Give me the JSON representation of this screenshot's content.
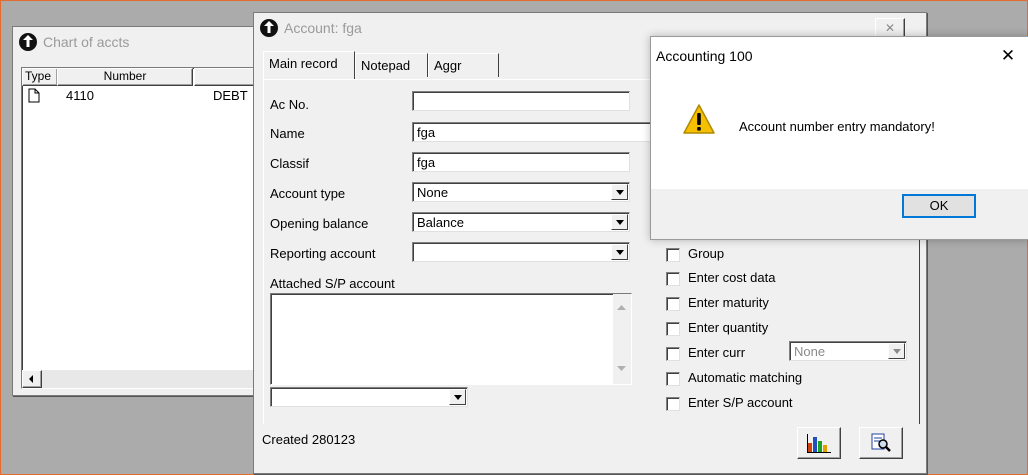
{
  "chart_window": {
    "title": "Chart of accts",
    "columns": [
      "Type",
      "Number",
      ""
    ],
    "rows": [
      {
        "number": "4110",
        "desc": "DEBT"
      }
    ]
  },
  "account_window": {
    "title": "Account: fga",
    "tabs": [
      "Main record",
      "Notepad",
      "Aggr"
    ],
    "fields": {
      "ac_no": {
        "label": "Ac No.",
        "value": ""
      },
      "name": {
        "label": "Name",
        "value": "fga"
      },
      "classif": {
        "label": "Classif",
        "value": "fga"
      },
      "account_type": {
        "label": "Account type",
        "value": "None"
      },
      "opening_balance": {
        "label": "Opening balance",
        "value": "Balance"
      },
      "reporting_account": {
        "label": "Reporting account",
        "value": ""
      },
      "attached_sp": {
        "label": "Attached S/P account"
      }
    },
    "checkboxes": [
      "Group",
      "Enter cost data",
      "Enter maturity",
      "Enter quantity",
      "Enter curr",
      "Automatic matching",
      "Enter S/P account"
    ],
    "curr_value": "None",
    "status": "Created 280123",
    "close_glyph": "✕"
  },
  "dialog": {
    "title": "Accounting 100",
    "close_glyph": "✕",
    "message": "Account number entry mandatory!",
    "ok_label": "OK"
  },
  "colors": {
    "frame_border": "#e46b2e",
    "background": "#ababab",
    "warning": "#f5c000"
  }
}
